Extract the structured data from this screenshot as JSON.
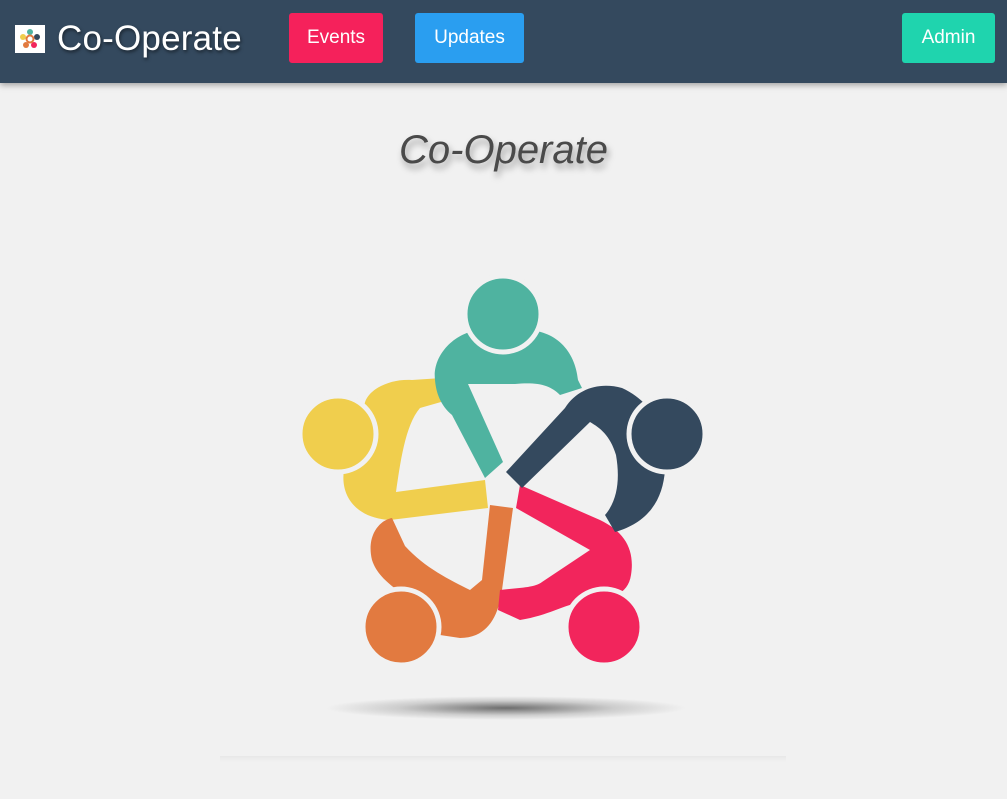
{
  "navbar": {
    "brand": {
      "logo_icon": "teamwork-logo-icon",
      "name": "Co-Operate"
    },
    "buttons": {
      "events": "Events",
      "updates": "Updates",
      "admin": "Admin"
    },
    "colors": {
      "background": "#34495e",
      "events": "#f5215b",
      "updates": "#2a9ef0",
      "admin": "#1fd4ae"
    }
  },
  "main": {
    "title": "Co-Operate",
    "hero_image": {
      "icon": "people-circle-teamwork-illustration",
      "figure_colors": [
        "#4fb3a0",
        "#34495e",
        "#f2255c",
        "#e27a40",
        "#f0ce4d"
      ]
    }
  }
}
